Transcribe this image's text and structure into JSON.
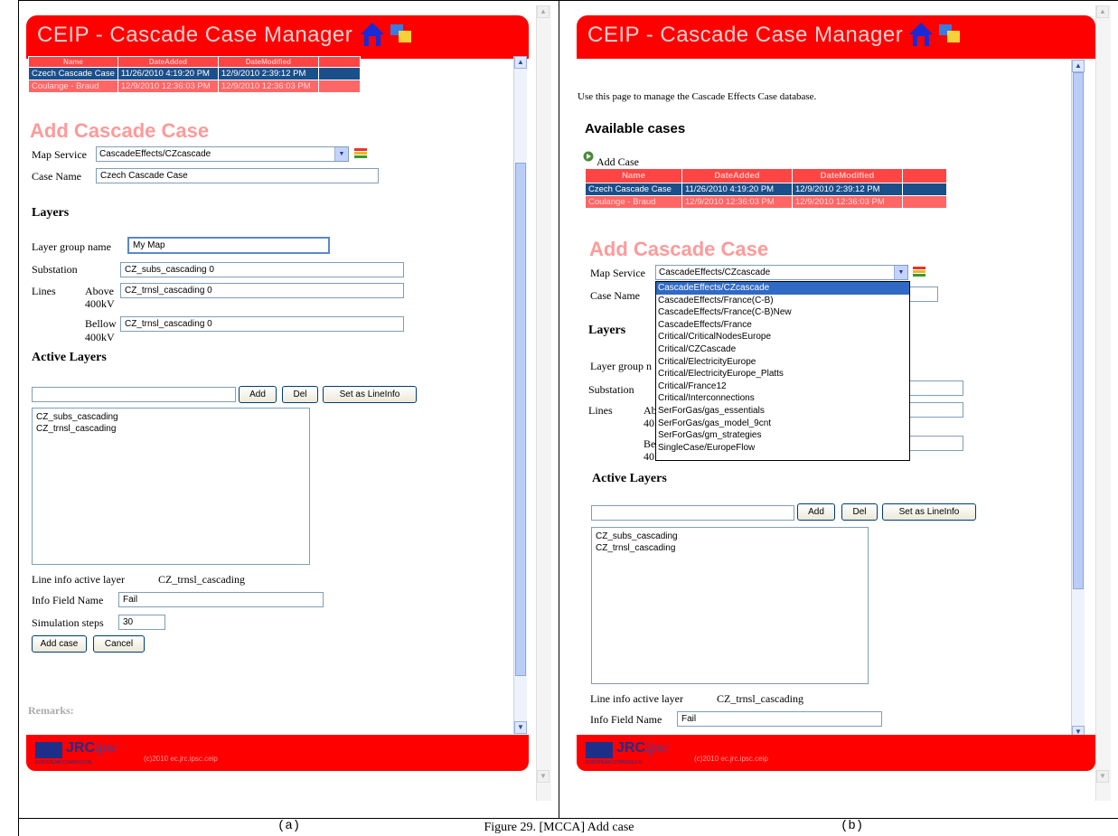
{
  "app_title": "CEIP - Cascade Case Manager",
  "table_headers": [
    "Name",
    "DateAdded",
    "DateModified"
  ],
  "cases": [
    {
      "name": "Czech Cascade Case",
      "added": "11/26/2010 4:19:20 PM",
      "modified": "12/9/2010 2:39:12 PM"
    },
    {
      "name": "Coulange - Braud",
      "added": "12/9/2010 12:36:03 PM",
      "modified": "12/9/2010 12:36:03 PM"
    }
  ],
  "panel_a": {
    "add_title": "Add Cascade Case",
    "map_service_label": "Map Service",
    "map_service_value": "CascadeEffects/CZcascade",
    "case_name_label": "Case Name",
    "case_name_value": "Czech Cascade Case",
    "layers_heading": "Layers",
    "layer_group_label": "Layer group name",
    "layer_group_value": "My Map",
    "substation_label": "Substation",
    "substation_value": "CZ_subs_cascading 0",
    "lines_label": "Lines",
    "above_label": "Above",
    "above_kv": "400kV",
    "above_value": "CZ_trnsl_cascading 0",
    "bellow_label": "Bellow",
    "bellow_kv": "400kV",
    "bellow_value": "CZ_trnsl_cascading 0",
    "active_layers_heading": "Active Layers",
    "add_btn": "Add",
    "del_btn": "Del",
    "set_lineinfo_btn": "Set as LineInfo",
    "active_layers": [
      "CZ_subs_cascading",
      "CZ_trnsl_cascading"
    ],
    "line_info_label": "Line info active layer",
    "line_info_value": "CZ_trnsl_cascading",
    "info_field_label": "Info Field Name",
    "info_field_value": "Fail",
    "sim_steps_label": "Simulation steps",
    "sim_steps_value": "30",
    "add_case_btn": "Add case",
    "cancel_btn": "Cancel",
    "remarks": "Remarks:"
  },
  "panel_b": {
    "intro": "Use this page to manage the Cascade Effects Case database.",
    "available_heading": "Available cases",
    "add_case_link": "Add Case",
    "add_title": "Add Cascade Case",
    "map_service_label": "Map Service",
    "map_service_value": "CascadeEffects/CZcascade",
    "case_name_label": "Case Name",
    "layers_heading": "Layers",
    "layer_group_partial": "Layer group n",
    "substation_label": "Substation",
    "lines_label": "Lines",
    "above_partial": "Ab",
    "above_kv_partial": "40",
    "bellow_partial": "Be",
    "bellow_kv_partial": "40",
    "dropdown_options": [
      "CascadeEffects/CZcascade",
      "CascadeEffects/France(C-B)",
      "CascadeEffects/France(C-B)New",
      "CascadeEffects/France",
      "Critical/CriticalNodesEurope",
      "Critical/CZCascade",
      "Critical/ElectricityEurope",
      "Critical/ElectricityEurope_Platts",
      "Critical/France12",
      "Critical/Interconnections",
      "SerForGas/gas_essentials",
      "SerForGas/gas_model_9cnt",
      "SerForGas/gm_strategies",
      "SingleCase/EuropeFlow"
    ],
    "active_layers_heading": "Active Layers",
    "add_btn": "Add",
    "del_btn": "Del",
    "set_lineinfo_btn": "Set as LineInfo",
    "active_layers": [
      "CZ_subs_cascading",
      "CZ_trnsl_cascading"
    ],
    "line_info_label": "Line info active layer",
    "line_info_value": "CZ_trnsl_cascading",
    "info_field_label": "Info Field Name",
    "info_field_value": "Fail"
  },
  "footer": {
    "jrc": "JRC",
    "ec": "EUROPEAN COMMISSION",
    "ipsc": "ipsc",
    "link": "(c)2010 ec.jrc.ipsc.ceip"
  },
  "sub_caption_a": "(a)",
  "sub_caption_b": "(b)",
  "caption": "Figure 29. [MCCA] Add case",
  "colors": {
    "header_red": "#ff0000",
    "selected_row": "#1a4f8a",
    "title_pink": "#ff9a9a"
  }
}
